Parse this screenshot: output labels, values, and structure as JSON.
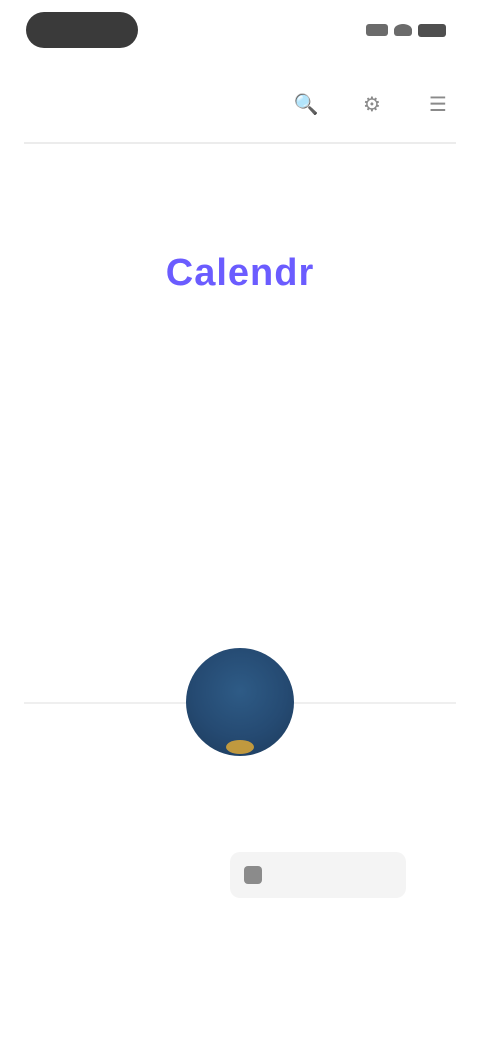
{
  "status_bar": {
    "time_pill": "",
    "icons": [
      "signal-icon",
      "wifi-icon",
      "battery-icon"
    ]
  },
  "app_bar": {
    "title": "",
    "actions": [
      "search-icon",
      "settings-icon",
      "menu-icon"
    ]
  },
  "top_right_small": "",
  "brand": {
    "name": "Calendr"
  },
  "description": {
    "line1": "",
    "line2": ""
  },
  "avatar": {
    "left_label": "",
    "right_label": "",
    "name": "",
    "side_note": ""
  },
  "primary_button": {
    "label": "",
    "icon": "google-icon",
    "note": ""
  },
  "colors": {
    "brand": "#6B5CFF",
    "avatar_bg": "#254A72",
    "accent": "#D2A23A"
  }
}
